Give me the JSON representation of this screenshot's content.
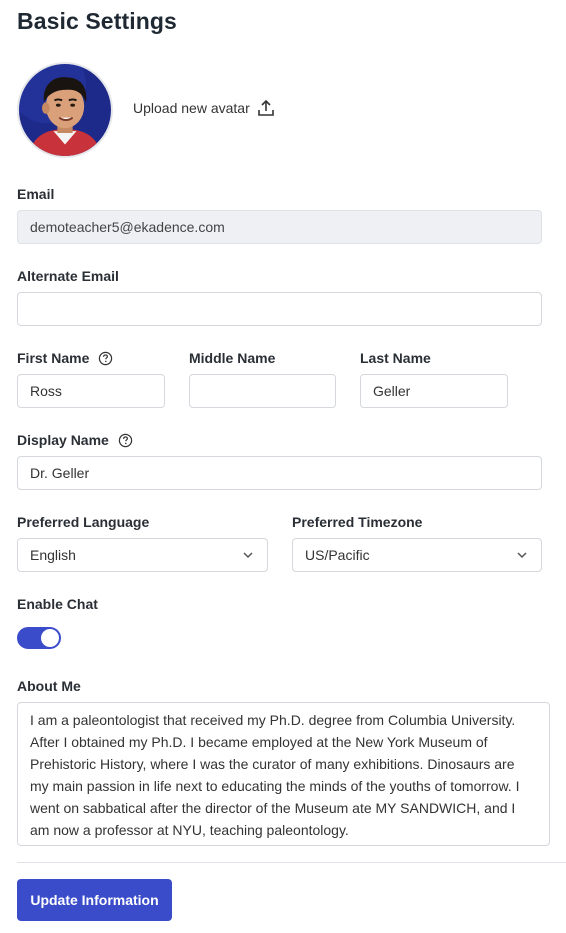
{
  "page": {
    "title": "Basic Settings"
  },
  "avatar": {
    "upload_label": "Upload new avatar",
    "upload_icon": "upload-icon"
  },
  "email": {
    "label": "Email",
    "value": "demoteacher5@ekadence.com"
  },
  "alternate_email": {
    "label": "Alternate Email",
    "value": "",
    "placeholder": ""
  },
  "first_name": {
    "label": "First Name",
    "value": "Ross",
    "help_icon": "help-circle-icon"
  },
  "middle_name": {
    "label": "Middle Name",
    "value": ""
  },
  "last_name": {
    "label": "Last Name",
    "value": "Geller"
  },
  "display_name": {
    "label": "Display Name",
    "value": "Dr. Geller",
    "help_icon": "help-circle-icon"
  },
  "preferred_language": {
    "label": "Preferred Language",
    "selected": "English"
  },
  "preferred_timezone": {
    "label": "Preferred Timezone",
    "selected": "US/Pacific"
  },
  "enable_chat": {
    "label": "Enable Chat",
    "enabled": true
  },
  "about_me": {
    "label": "About Me",
    "value": "I am a paleontologist that received my Ph.D. degree from Columbia University. After I obtained my Ph.D. I became employed at the New York Museum of Prehistoric History, where I was the curator of many exhibitions. Dinosaurs are my main passion in life next to educating the minds of the youths of tomorrow. I went on sabbatical after the director of the Museum ate MY SANDWICH, and I am now a professor at NYU, teaching paleontology."
  },
  "actions": {
    "update_label": "Update Information"
  },
  "colors": {
    "accent": "#3b4cca",
    "readonly_bg": "#eef0f3",
    "border": "#d4d7dc"
  }
}
